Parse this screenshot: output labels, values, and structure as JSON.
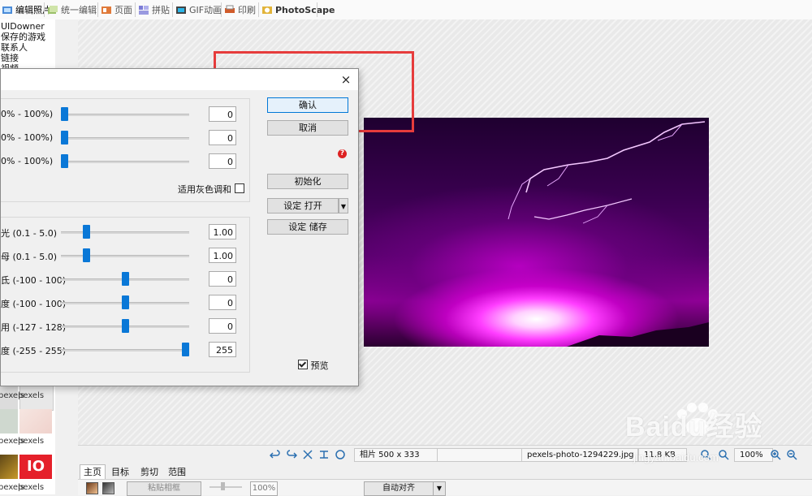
{
  "tabs": [
    {
      "label": "编辑照片",
      "active": true
    },
    {
      "label": "统一编辑"
    },
    {
      "label": "页面"
    },
    {
      "label": "拼贴"
    },
    {
      "label": "GIF动画"
    },
    {
      "label": "印刷"
    },
    {
      "label": "PhotoScape"
    }
  ],
  "folder_tree": [
    "UIDowner",
    "保存的游戏",
    "联系人",
    "链接",
    "视频"
  ],
  "thumbnails": [
    {
      "label": "pexels"
    },
    {
      "label": "pexels"
    },
    {
      "label": "pexels"
    },
    {
      "label": "pexels"
    }
  ],
  "dialog": {
    "close_glyph": "×",
    "rows_top": [
      {
        "label": "0% - 100%)",
        "value": "0",
        "pos": 0.0
      },
      {
        "label": "0% - 100%)",
        "value": "0",
        "pos": 0.0
      },
      {
        "label": "0% - 100%)",
        "value": "0",
        "pos": 0.0
      }
    ],
    "grayscale_label": "适用灰色调和",
    "rows_bottom": [
      {
        "label": "光 (0.1 - 5.0)",
        "value": "1.00",
        "pos": 0.18
      },
      {
        "label": "母 (0.1 - 5.0)",
        "value": "1.00",
        "pos": 0.18
      },
      {
        "label": "氐 (-100 - 100)",
        "value": "0",
        "pos": 0.5
      },
      {
        "label": "度 (-100 - 100)",
        "value": "0",
        "pos": 0.5
      },
      {
        "label": "用 (-127 - 128)",
        "value": "0",
        "pos": 0.5
      },
      {
        "label": "度 (-255 - 255)",
        "value": "255",
        "pos": 1.0
      }
    ],
    "buttons": {
      "confirm": "确认",
      "cancel": "取消",
      "reset": "初始化",
      "load_settings": "设定 打开",
      "save_settings": "设定 储存"
    },
    "preview_label": "预览"
  },
  "status": {
    "size": "相片 500 x 333",
    "filename": "pexels-photo-1294229.jpg",
    "filesize": "11.8 KB",
    "zoom": "100%"
  },
  "bottom_tabs": [
    "主页",
    "目标",
    "剪切",
    "范围"
  ],
  "bottom_tools": {
    "paste_frame": "粘贴相框",
    "zoom": "100%",
    "auto_align": "自动对齐"
  },
  "watermark": {
    "brand": "Baidu经验",
    "url": "jingyan.baidu.com"
  },
  "colors": {
    "accent": "#0a78d7",
    "annotation": "#e63c3c"
  }
}
